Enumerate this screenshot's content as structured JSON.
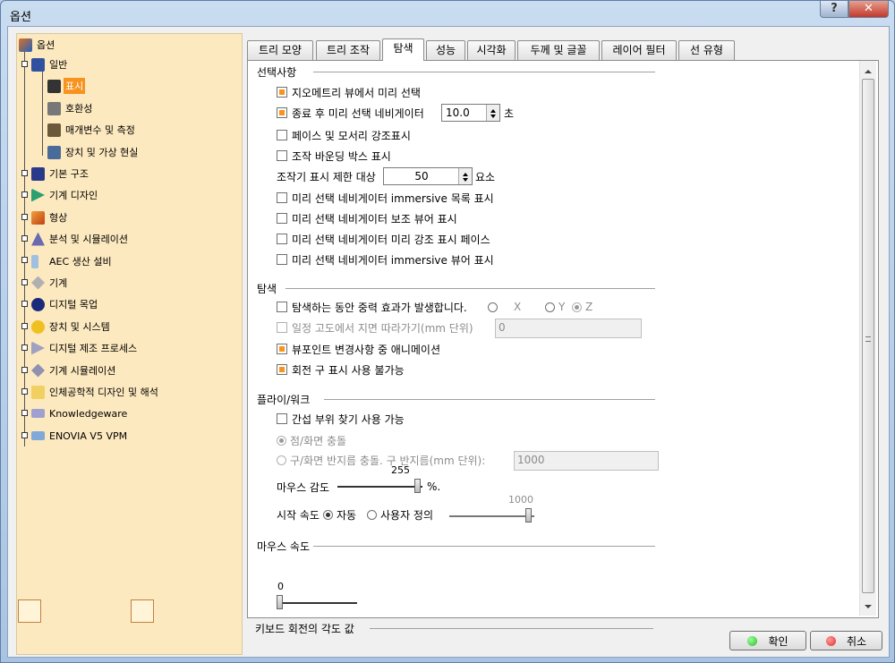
{
  "window": {
    "title": "옵션",
    "help_glyph": "?",
    "close_glyph": "✕"
  },
  "tree": {
    "root": "옵션",
    "items": [
      {
        "label": "일반",
        "icon": "general-icon"
      },
      {
        "label": "표시",
        "icon": "display-icon",
        "selected": true
      },
      {
        "label": "호환성",
        "icon": "compatibility-icon"
      },
      {
        "label": "매개변수 및 측정",
        "icon": "parameters-icon"
      },
      {
        "label": "장치 및 가상 현실",
        "icon": "devices-icon"
      },
      {
        "label": "기본 구조",
        "icon": "infrastructure-icon"
      },
      {
        "label": "기계 디자인",
        "icon": "mechanical-design-icon"
      },
      {
        "label": "형상",
        "icon": "shape-icon"
      },
      {
        "label": "분석 및 시뮬레이션",
        "icon": "analysis-icon"
      },
      {
        "label": "AEC 생산 설비",
        "icon": "aec-plant-icon"
      },
      {
        "label": "기계",
        "icon": "machining-icon"
      },
      {
        "label": "디지털 목업",
        "icon": "digital-mockup-icon"
      },
      {
        "label": "장치 및 시스템",
        "icon": "equipment-icon"
      },
      {
        "label": "디지털 제조 프로세스",
        "icon": "manufacturing-icon"
      },
      {
        "label": "기계 시뮬레이션",
        "icon": "machine-simulation-icon"
      },
      {
        "label": "인체공학적 디자인 및 해석",
        "icon": "ergonomics-icon"
      },
      {
        "label": "Knowledgeware",
        "icon": "knowledgeware-icon"
      },
      {
        "label": "ENOVIA V5 VPM",
        "icon": "enovia-icon"
      }
    ]
  },
  "tabs": [
    "트리 모양",
    "트리 조작",
    "탐색",
    "성능",
    "시각화",
    "두께 및 글꼴",
    "레이어 필터",
    "선 유형"
  ],
  "active_tab": "탐색",
  "sections": {
    "selection": {
      "title": "선택사항",
      "geometry_preselect": "지오메트리 뷰에서 미리 선택",
      "navigator_after": "종료 후 미리 선택 네비게이터",
      "navigator_value": "10.0",
      "navigator_unit": "초",
      "highlight_faces": "페이스 및 모서리 강조표시",
      "bounding_box": "조작 바운딩 박스 표시",
      "limit_label": "조작기 표시 제한 대상",
      "limit_value": "50",
      "limit_unit": "요소",
      "immersive_list": "미리 선택 네비게이터 immersive 목록 표시",
      "aux_viewer": "미리 선택 네비게이터 보조 뷰어 표시",
      "highlight_preselect": "미리 선택 네비게이터 미리 강조 표시 페이스",
      "immersive_viewer": "미리 선택 네비게이터 immersive 뷰어 표시"
    },
    "navigation": {
      "title": "탐색",
      "gravity": "탐색하는 동안 중력 효과가 발생합니다.",
      "axis_x": "X",
      "axis_y": "Y",
      "axis_z": "Z",
      "ground_follow": "일정 고도에서 지면 따라가기(mm 단위)",
      "ground_value": "0",
      "viewpoint_anim": "뷰포인트 변경사항 중 애니메이션",
      "disable_sphere": "회전 구 표시 사용 불가능"
    },
    "fly": {
      "title": "플라이/워크",
      "collision": "간섭 부위 찾기 사용 가능",
      "point_surface": "점/화면 충돌",
      "sphere_surface": "구/화면 반지름 충돌. 구 반지름(mm 단위):",
      "sphere_value": "1000",
      "mouse_sens_label": "마우스 감도",
      "mouse_sens_value": "255",
      "mouse_sens_unit": "%.",
      "start_speed_label": "시작 속도",
      "auto": "자동",
      "user_defined": "사용자 정의",
      "start_speed_value": "1000"
    },
    "mouse_speed": {
      "title": "마우스 속도",
      "value": "0"
    },
    "keyboard": {
      "title": "키보드 회전의 각도 값"
    }
  },
  "buttons": {
    "ok": "확인",
    "cancel": "취소"
  },
  "colors": {
    "accent": "#f7931e",
    "tree_bg": "#fde9bf",
    "ok_dot": "#2eb82e",
    "cancel_dot": "#e03030"
  }
}
